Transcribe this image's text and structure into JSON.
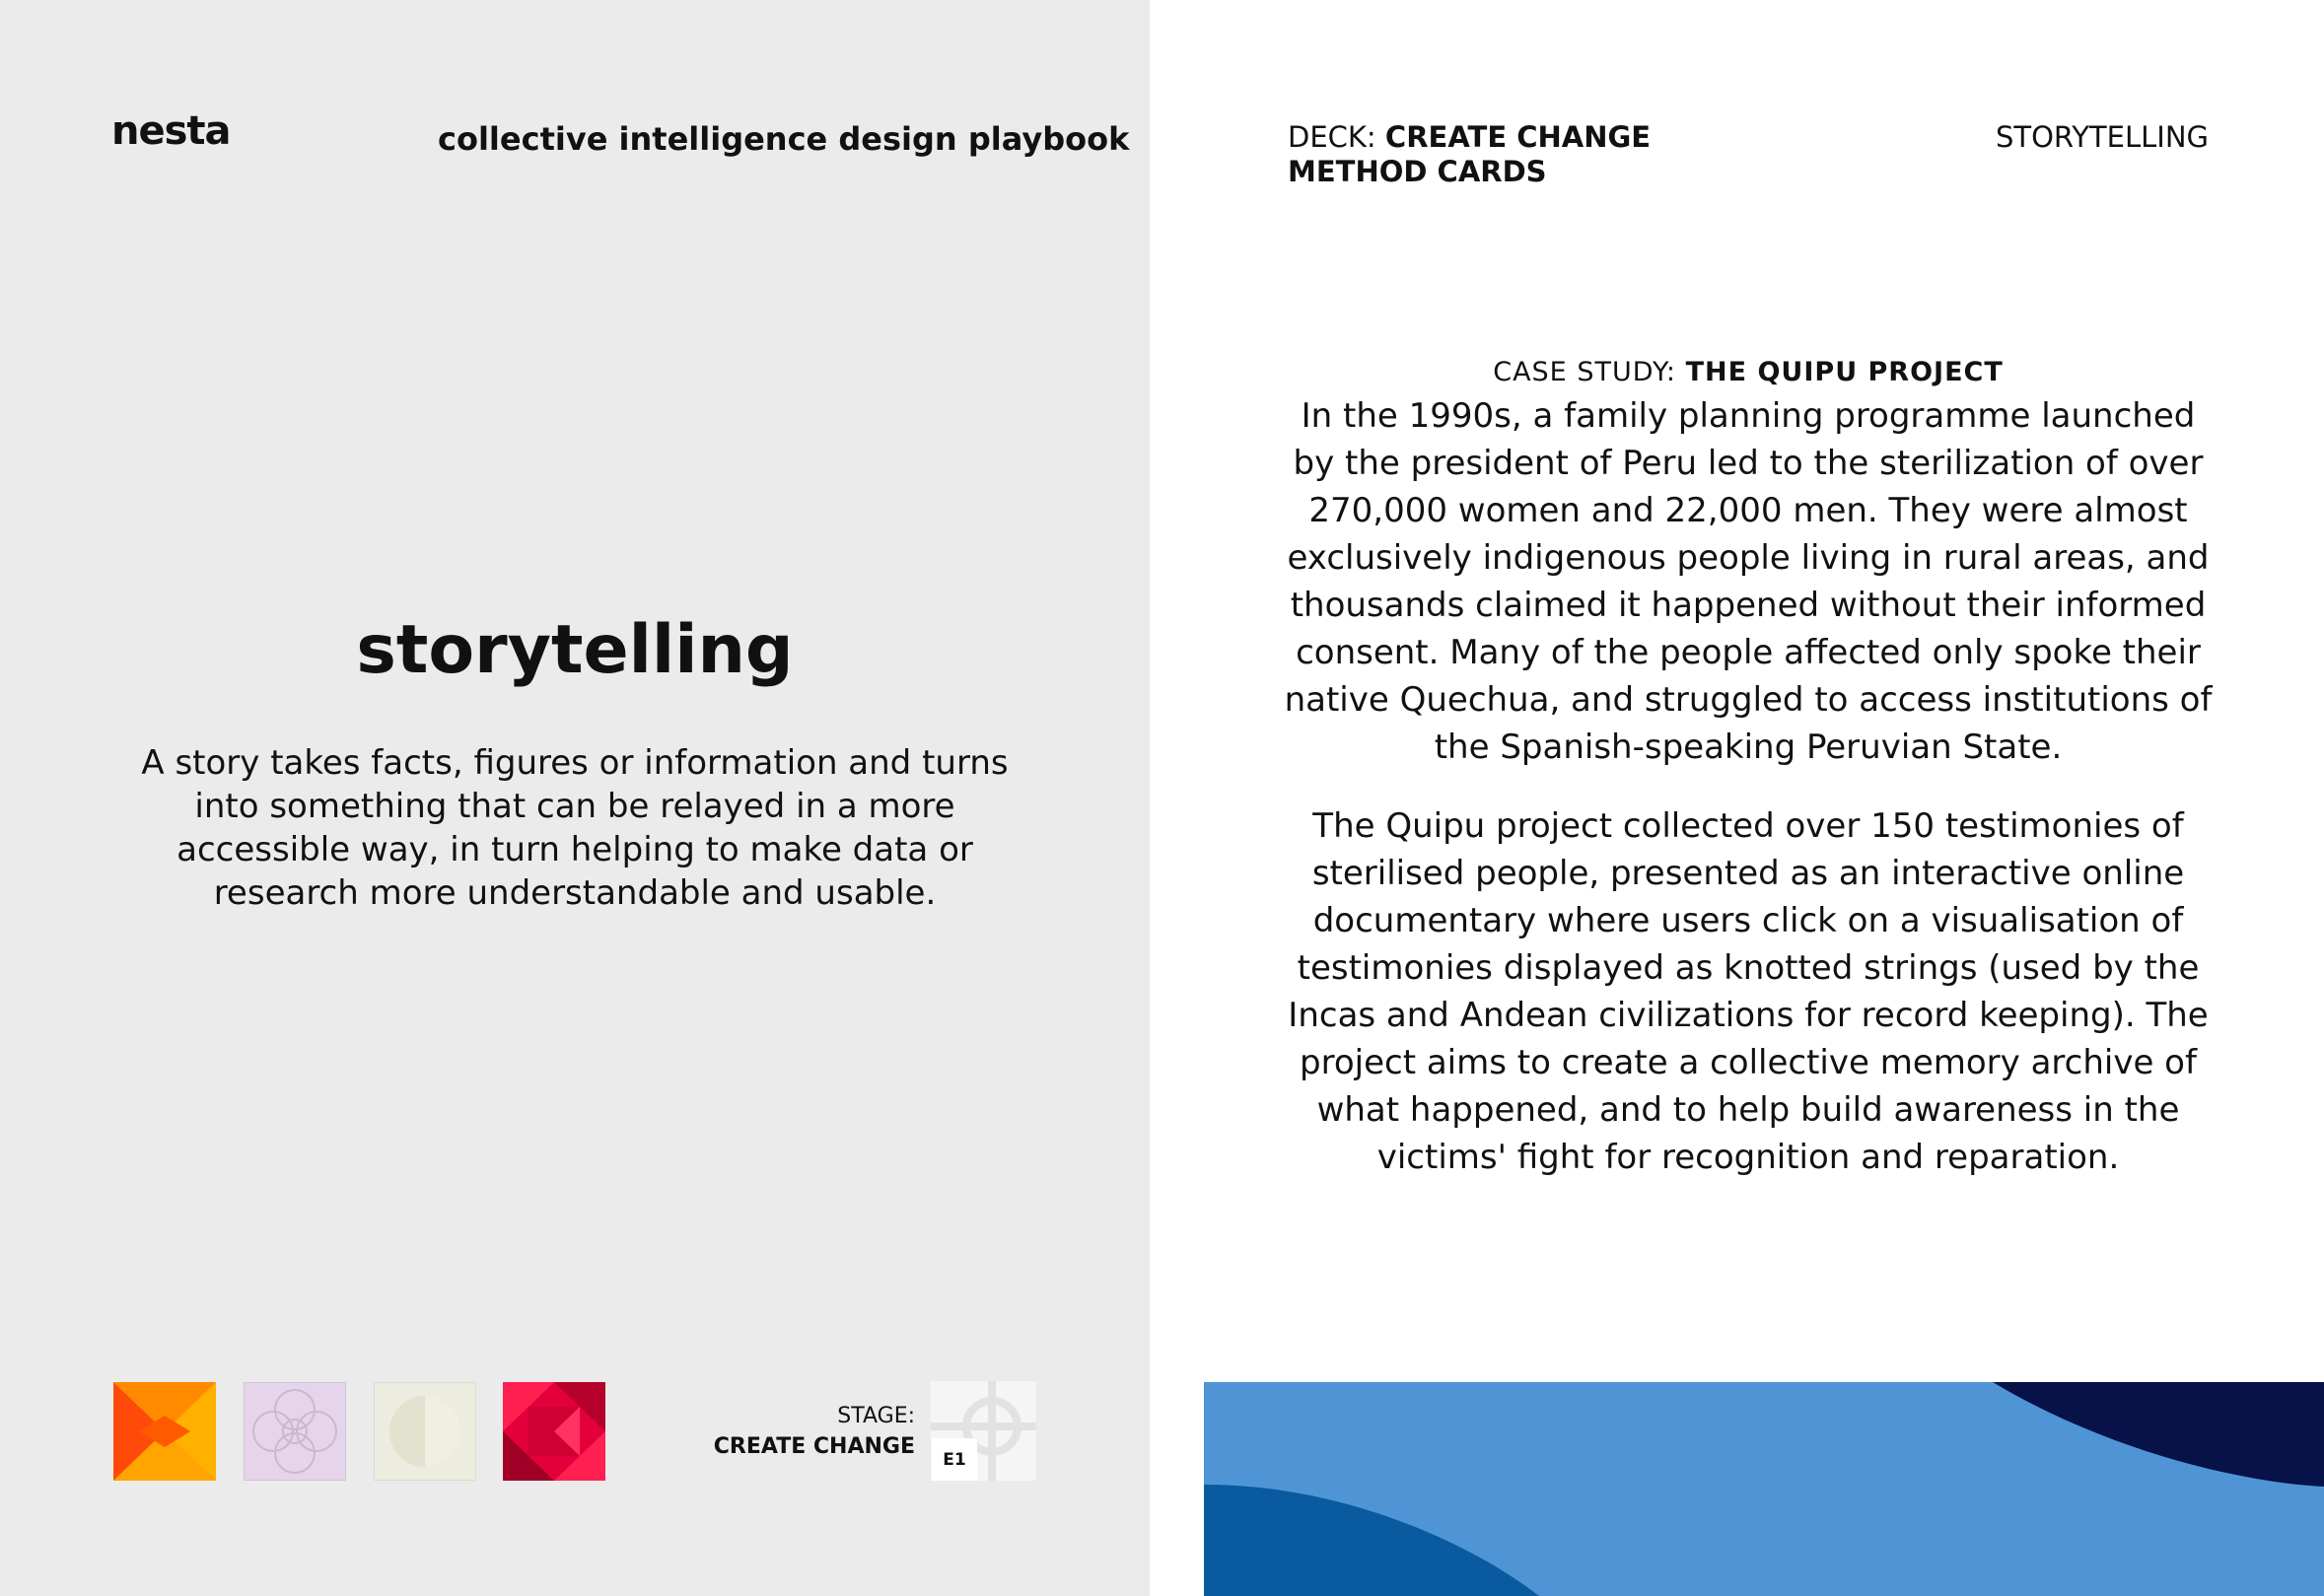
{
  "left_card": {
    "logo": "nesta",
    "playbook_title": "collective intelligence design playbook",
    "title": "storytelling",
    "description": "A story takes facts, figures or information and turns into something that can be relayed in a more accessible way, in turn helping to make data or research more understandable and usable.",
    "stage_label": "STAGE:",
    "stage_value": "CREATE CHANGE",
    "stage_code": "E1"
  },
  "right_card": {
    "deck_prefix": "DECK: ",
    "deck_line1": "CREATE CHANGE",
    "deck_line2": "METHOD CARDS",
    "topic": "STORYTELLING",
    "case_study_prefix": "CASE STUDY: ",
    "case_study_name": "THE QUIPU PROJECT",
    "paragraph1": "In the 1990s, a family planning programme launched by the president of Peru led to the sterilization of over 270,000 women and 22,000 men. They were almost exclusively indigenous people living in rural areas, and thousands claimed it happened without their informed consent. Many of the people affected only spoke their native Quechua, and struggled to access institutions of the Spanish-speaking Peruvian State.",
    "paragraph2": "The Quipu project collected over 150 testimonies of sterilised people, presented as an interactive online documentary where users click on a visualisation of testimonies displayed as knotted strings (used by the Incas and Andean civilizations for record keeping). The project aims to create a collective memory archive of what happened, and to help build awareness in the victims' fight for recognition and reparation."
  },
  "colors": {
    "left_background": "#ebebeb",
    "right_background": "#ffffff",
    "wave_light_blue": "#4f95d6",
    "wave_mid_blue": "#0a5aa0",
    "wave_dark_navy": "#061248"
  }
}
